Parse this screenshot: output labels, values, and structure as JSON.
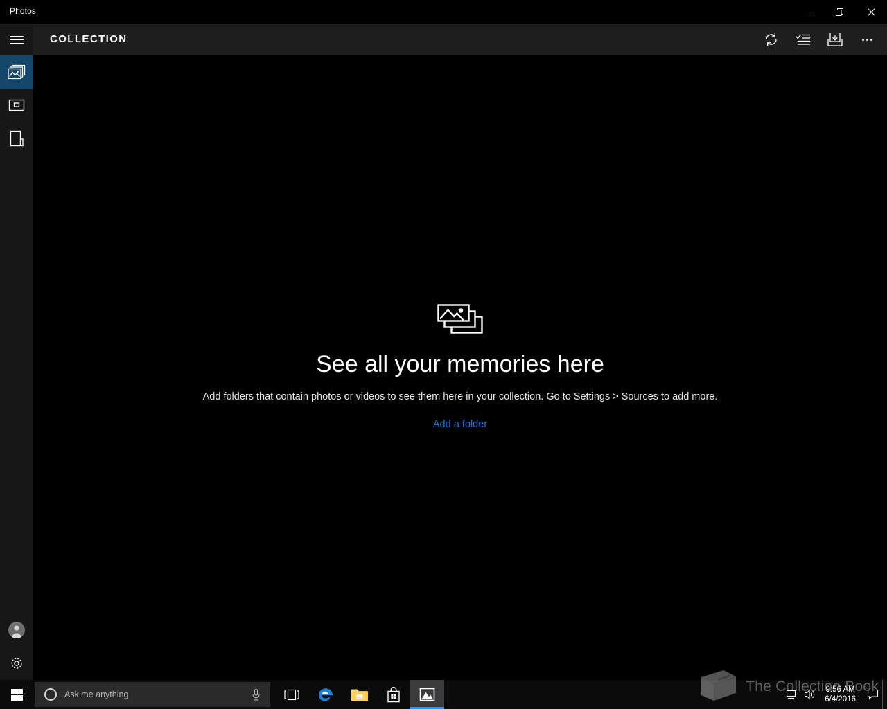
{
  "window": {
    "title": "Photos",
    "controls": [
      {
        "name": "minimize",
        "label": "Minimize"
      },
      {
        "name": "maximize",
        "label": "Restore"
      },
      {
        "name": "close",
        "label": "Close"
      }
    ]
  },
  "header": {
    "menu_label": "Menu",
    "title": "COLLECTION",
    "actions": [
      {
        "name": "refresh",
        "label": "Refresh"
      },
      {
        "name": "select",
        "label": "Select"
      },
      {
        "name": "import",
        "label": "Import"
      },
      {
        "name": "more",
        "label": "See more"
      }
    ]
  },
  "sidebar": {
    "items": [
      {
        "name": "collection",
        "label": "Collection",
        "selected": true
      },
      {
        "name": "albums",
        "label": "Albums",
        "selected": false
      },
      {
        "name": "folders",
        "label": "Folders",
        "selected": false
      }
    ],
    "bottom": [
      {
        "name": "account",
        "label": "Account"
      },
      {
        "name": "settings",
        "label": "Settings"
      }
    ]
  },
  "main": {
    "empty_state": {
      "icon": "photos-stack-icon",
      "title": "See all your memories here",
      "description": "Add folders that contain photos or videos to see them here in your collection. Go to Settings > Sources to add more.",
      "link_label": "Add a folder"
    }
  },
  "taskbar": {
    "start_label": "Start",
    "search": {
      "placeholder": "Ask me anything",
      "value": "",
      "mic_label": "Speak to Cortana"
    },
    "apps": [
      {
        "name": "task-view",
        "label": "Task View",
        "active": false
      },
      {
        "name": "edge",
        "label": "Microsoft Edge",
        "active": false
      },
      {
        "name": "file-explorer",
        "label": "File Explorer",
        "active": false
      },
      {
        "name": "store",
        "label": "Microsoft Store",
        "active": false
      },
      {
        "name": "photos",
        "label": "Photos",
        "active": true
      }
    ],
    "tray": {
      "network_label": "Network",
      "volume_label": "Speakers",
      "time": "9:56 AM",
      "date": "6/4/2016",
      "action_center_label": "Action Center"
    }
  },
  "watermark": {
    "text": "The Collection Book"
  },
  "colors": {
    "accent": "#14466b",
    "link": "#2a6fd4",
    "taskbar_active": "#3e8fd6",
    "header_bg": "#1f1f1f",
    "rail_bg": "#171717",
    "content_bg": "#000000"
  }
}
